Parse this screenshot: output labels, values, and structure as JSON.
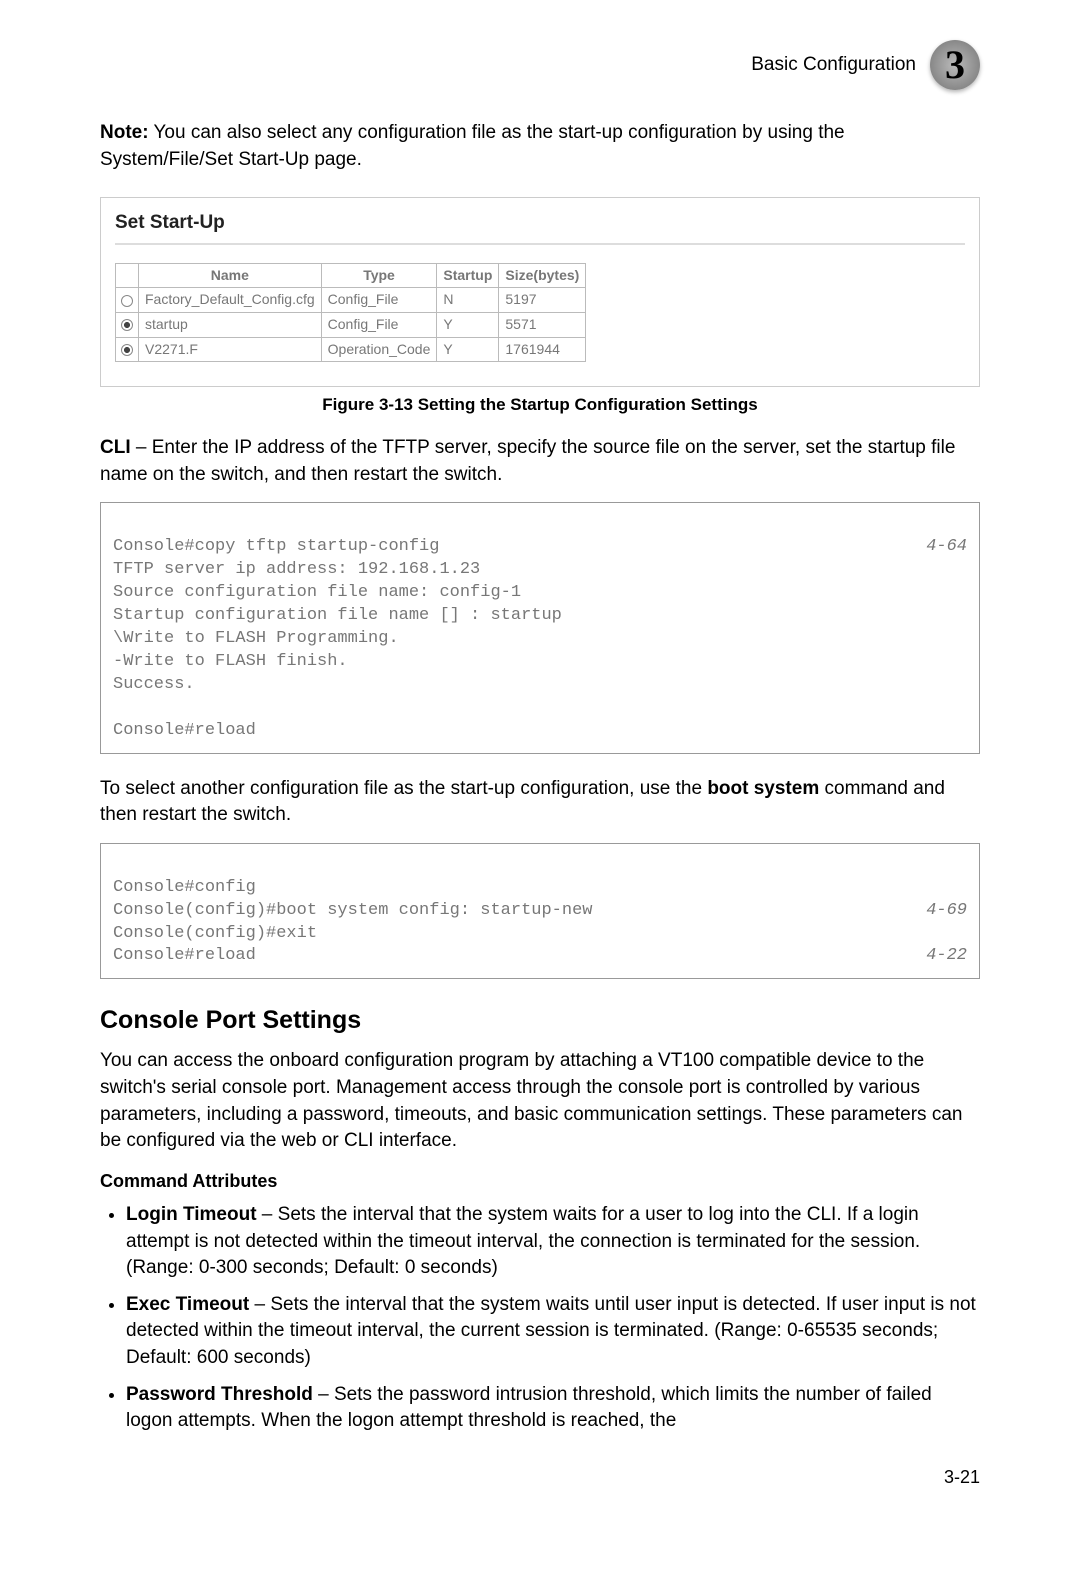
{
  "header": {
    "title": "Basic Configuration",
    "chapter": "3"
  },
  "note": {
    "label": "Note:",
    "text": "You can also select any configuration file as the start-up configuration by using the System/File/Set Start-Up page."
  },
  "screenshot": {
    "title": "Set Start-Up",
    "headers": [
      "Name",
      "Type",
      "Startup",
      "Size(bytes)"
    ],
    "rows": [
      {
        "selected": false,
        "name": "Factory_Default_Config.cfg",
        "type": "Config_File",
        "startup": "N",
        "size": "5197"
      },
      {
        "selected": true,
        "name": "startup",
        "type": "Config_File",
        "startup": "Y",
        "size": "5571"
      },
      {
        "selected": true,
        "name": "V2271.F",
        "type": "Operation_Code",
        "startup": "Y",
        "size": "1761944"
      }
    ]
  },
  "figure_caption": "Figure 3-13  Setting the Startup Configuration Settings",
  "cli_intro": {
    "label": "CLI",
    "text": " – Enter the IP address of the TFTP server, specify the source file on the server, set the startup file name on the switch, and then restart the switch."
  },
  "code1": {
    "line1_left": "Console#copy tftp startup-config",
    "line1_ref": "4-64",
    "body": "TFTP server ip address: 192.168.1.23\nSource configuration file name: config-1\nStartup configuration file name [] : startup\n\\Write to FLASH Programming.\n-Write to FLASH finish.\nSuccess.\n\nConsole#reload"
  },
  "mid_text": {
    "before": "To select another configuration file as the start-up configuration, use the ",
    "bold": "boot system",
    "after": " command and then restart the switch."
  },
  "code2": {
    "line1": "Console#config",
    "line2_left": "Console(config)#boot system config: startup-new",
    "line2_ref": "4-69",
    "line3": "Console(config)#exit",
    "line4_left": "Console#reload",
    "line4_ref": "4-22"
  },
  "section": {
    "heading": "Console Port Settings",
    "para": "You can access the onboard configuration program by attaching a VT100 compatible device to the switch's serial console port. Management access through the console port is controlled by various parameters, including a password, timeouts, and basic communication settings. These parameters can be configured via the web or CLI interface.",
    "subheading": "Command Attributes",
    "items": [
      {
        "label": "Login Timeout",
        "text": " – Sets the interval that the system waits for a user to log into the CLI. If a login attempt is not detected within the timeout interval, the connection is terminated for the session. (Range: 0-300 seconds; Default: 0 seconds)"
      },
      {
        "label": "Exec Timeout",
        "text": " – Sets the interval that the system waits until user input is detected. If user input is not detected within the timeout interval, the current session is terminated. (Range: 0-65535 seconds; Default: 600 seconds)"
      },
      {
        "label": "Password Threshold",
        "text": " – Sets the password intrusion threshold, which limits the number of failed logon attempts. When the logon attempt threshold is reached, the"
      }
    ]
  },
  "page_number": "3-21"
}
